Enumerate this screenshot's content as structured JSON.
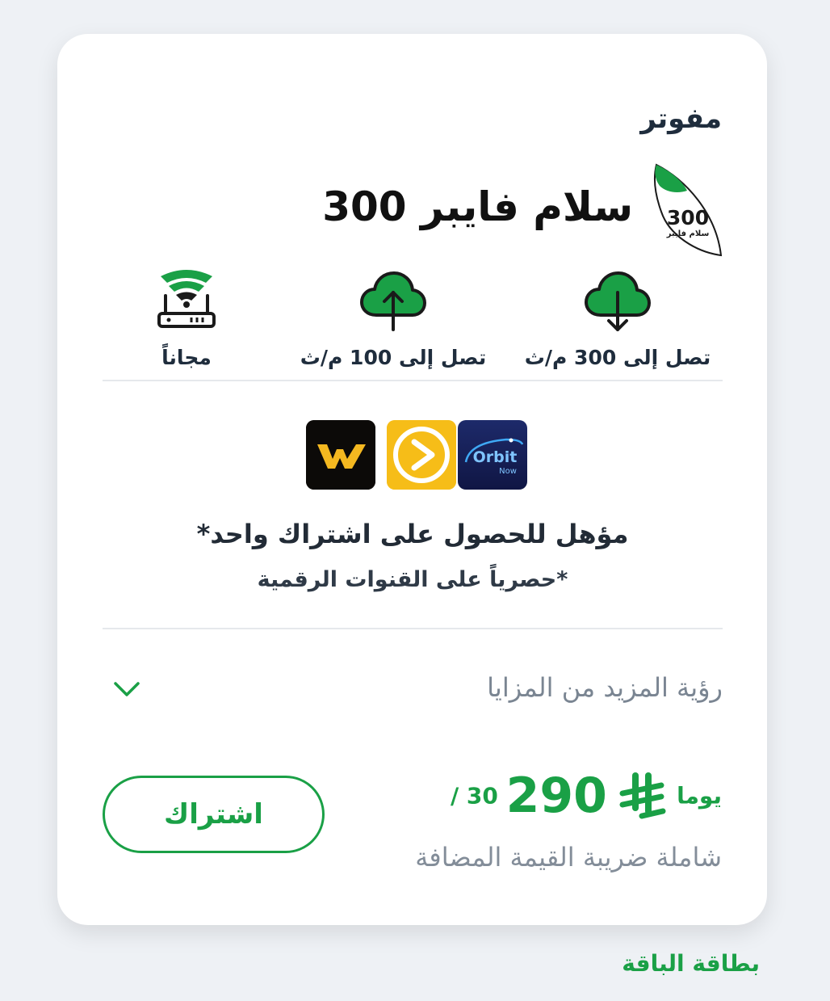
{
  "card": {
    "type_label": "مفوتر",
    "plan_name": "سلام فايبر 300",
    "badge": {
      "number": "300",
      "caption": "سلام فايبر"
    },
    "features": [
      {
        "text": "تصل إلى 300 م/ث",
        "icon": "cloud-download-icon"
      },
      {
        "text": "تصل إلى 100 م/ث",
        "icon": "cloud-upload-icon"
      },
      {
        "text": "مجاناً",
        "icon": "wifi-router-icon"
      }
    ],
    "apps": [
      {
        "name": "Orbit",
        "sub": "Now"
      },
      {
        "name": "play"
      },
      {
        "name": "W"
      }
    ],
    "eligible_text": "مؤهل للحصول على اشتراك واحد*",
    "exclusive_text": "*حصرياً على القنوات الرقمية",
    "more_benefits": "رؤية المزيد من المزايا",
    "price": {
      "amount": "290",
      "duration": "/ 30 يوما",
      "vat_note": "شاملة ضريبة القيمة المضافة"
    },
    "subscribe_label": "اشتراك"
  },
  "footer": {
    "label": "بطاقة الباقة"
  },
  "colors": {
    "brand_green": "#1aa046",
    "text_dark": "#1f2d3d",
    "muted": "#7a8592"
  }
}
